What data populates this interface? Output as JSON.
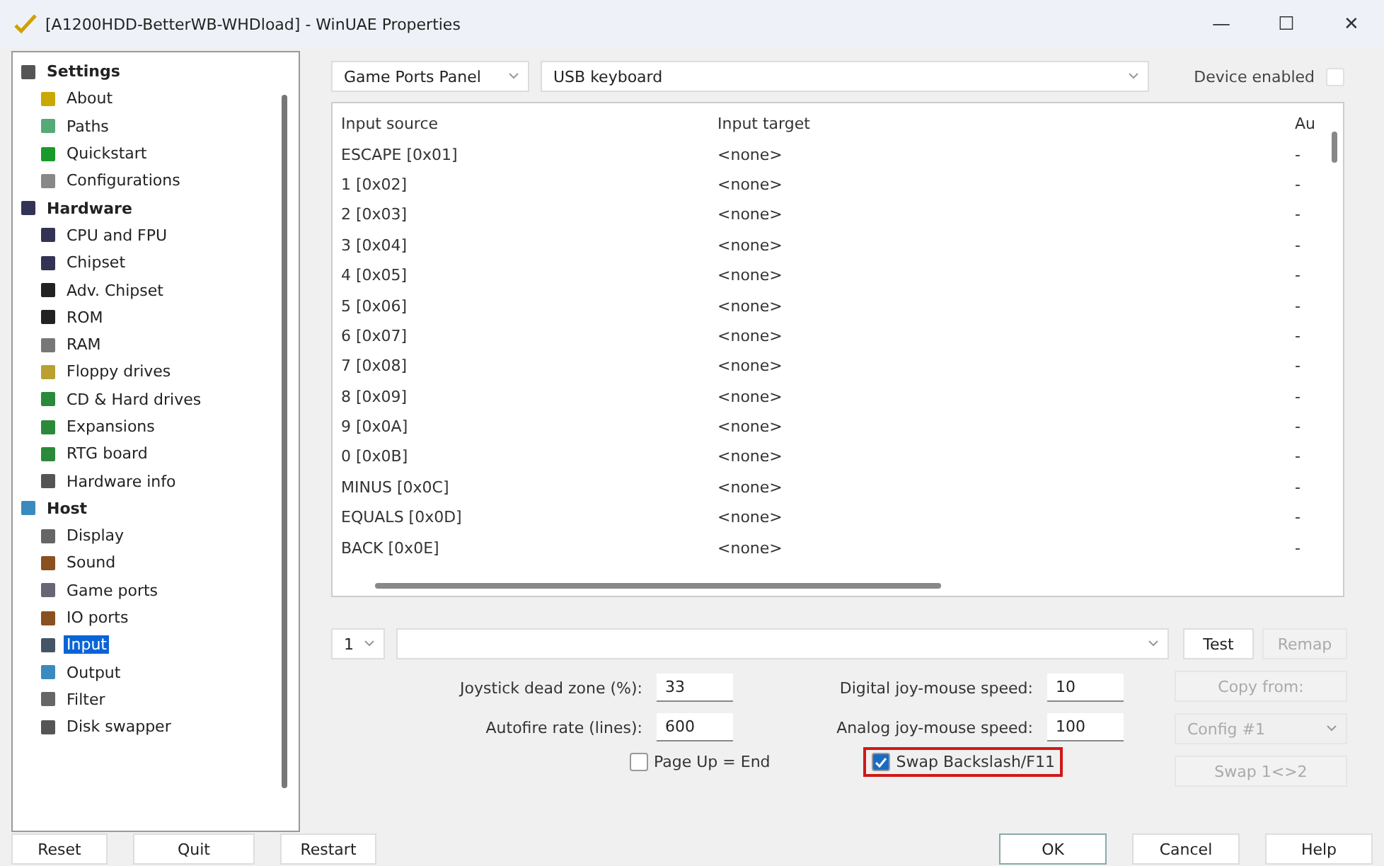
{
  "window": {
    "title": "[A1200HDD-BetterWB-WHDload] - WinUAE Properties",
    "controls": [
      "—",
      "☐",
      "✕"
    ]
  },
  "sidebar": {
    "items": [
      {
        "label": "Settings",
        "bold": true,
        "selected": false,
        "children": [
          {
            "label": "About",
            "selected": false
          },
          {
            "label": "Paths",
            "selected": false
          },
          {
            "label": "Quickstart",
            "selected": false
          },
          {
            "label": "Configurations",
            "selected": false
          }
        ]
      },
      {
        "label": "Hardware",
        "bold": true,
        "selected": false,
        "children": [
          {
            "label": "CPU and FPU",
            "selected": false
          },
          {
            "label": "Chipset",
            "selected": false
          },
          {
            "label": "Adv. Chipset",
            "selected": false
          },
          {
            "label": "ROM",
            "selected": false
          },
          {
            "label": "RAM",
            "selected": false
          },
          {
            "label": "Floppy drives",
            "selected": false
          },
          {
            "label": "CD & Hard drives",
            "selected": false
          },
          {
            "label": "Expansions",
            "selected": false
          },
          {
            "label": "RTG board",
            "selected": false
          },
          {
            "label": "Hardware info",
            "selected": false
          }
        ]
      },
      {
        "label": "Host",
        "bold": true,
        "selected": false,
        "children": [
          {
            "label": "Display",
            "selected": false
          },
          {
            "label": "Sound",
            "selected": false
          },
          {
            "label": "Game ports",
            "selected": false
          },
          {
            "label": "IO ports",
            "selected": false
          },
          {
            "label": "Input",
            "selected": true
          },
          {
            "label": "Output",
            "selected": false
          },
          {
            "label": "Filter",
            "selected": false
          },
          {
            "label": "Disk swapper",
            "selected": false
          }
        ]
      }
    ]
  },
  "top": {
    "panel_dropdown": "Game Ports Panel",
    "device_dropdown": "USB keyboard",
    "device_enabled": {
      "label": "Device enabled",
      "checked": false
    }
  },
  "table": {
    "columns": [
      "Input source",
      "Input target",
      "Au"
    ],
    "rows": [
      [
        "ESCAPE [0x01]",
        "<none>",
        "-"
      ],
      [
        "1 [0x02]",
        "<none>",
        "-"
      ],
      [
        "2 [0x03]",
        "<none>",
        "-"
      ],
      [
        "3 [0x04]",
        "<none>",
        "-"
      ],
      [
        "4 [0x05]",
        "<none>",
        "-"
      ],
      [
        "5 [0x06]",
        "<none>",
        "-"
      ],
      [
        "6 [0x07]",
        "<none>",
        "-"
      ],
      [
        "7 [0x08]",
        "<none>",
        "-"
      ],
      [
        "8 [0x09]",
        "<none>",
        "-"
      ],
      [
        "9 [0x0A]",
        "<none>",
        "-"
      ],
      [
        "0 [0x0B]",
        "<none>",
        "-"
      ],
      [
        "MINUS [0x0C]",
        "<none>",
        "-"
      ],
      [
        "EQUALS [0x0D]",
        "<none>",
        "-"
      ],
      [
        "BACK [0x0E]",
        "<none>",
        "-"
      ]
    ]
  },
  "controls": {
    "slot_dropdown": "1",
    "test_button": {
      "label": "Test",
      "disabled": false
    },
    "remap_button": {
      "label": "Remap",
      "disabled": true
    },
    "fields": [
      {
        "label": "Joystick dead zone (%):",
        "value": "33"
      },
      {
        "label": "Digital joy-mouse speed:",
        "value": "10"
      },
      {
        "label": "Autofire rate (lines):",
        "value": "600"
      },
      {
        "label": "Analog joy-mouse speed:",
        "value": "100"
      }
    ],
    "copy_from": {
      "label": "Copy from:",
      "disabled": true
    },
    "config_dropdown": {
      "label": "Config #1",
      "disabled": true
    },
    "swap_button": {
      "label": "Swap 1<>2",
      "disabled": true
    },
    "checkboxes": [
      {
        "label": "Page Up = End",
        "checked": false,
        "highlighted": false
      },
      {
        "label": "Swap Backslash/F11",
        "checked": true,
        "highlighted": true
      }
    ]
  },
  "footer": {
    "left": [
      "Reset",
      "Quit",
      "Restart"
    ],
    "right": [
      "OK",
      "Cancel",
      "Help"
    ]
  }
}
